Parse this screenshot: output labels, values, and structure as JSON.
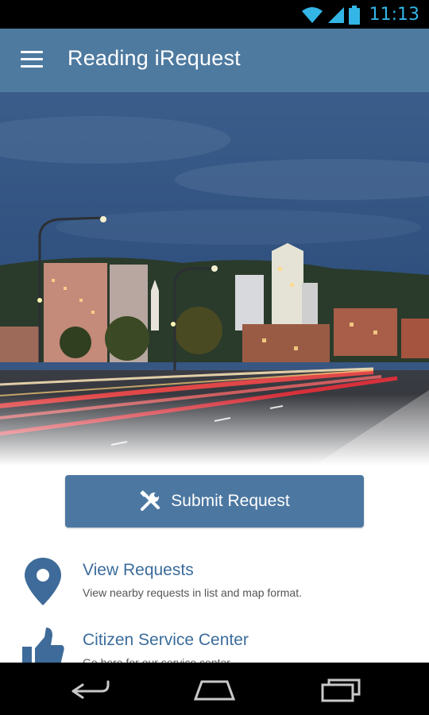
{
  "status_bar": {
    "time": "11:13",
    "icons": [
      "wifi-icon",
      "cell-signal-icon",
      "battery-icon"
    ],
    "color": "#33b5e5"
  },
  "app_bar": {
    "title": "Reading iRequest",
    "menu_icon": "hamburger-menu-icon",
    "background": "#4e7aa0"
  },
  "hero": {
    "description_icon": "city-skyline-photo"
  },
  "submit": {
    "label": "Submit Request",
    "icon": "tools-icon",
    "background": "#4c77a1"
  },
  "menu_items": [
    {
      "title": "View Requests",
      "description": "View nearby requests in list and map format.",
      "icon": "map-pin-icon"
    },
    {
      "title": "Citizen Service Center",
      "description": "Go here for our service center",
      "icon": "thumbs-up-icon"
    }
  ],
  "nav_bar": {
    "buttons": [
      "back-icon",
      "home-icon",
      "recent-apps-icon"
    ]
  }
}
